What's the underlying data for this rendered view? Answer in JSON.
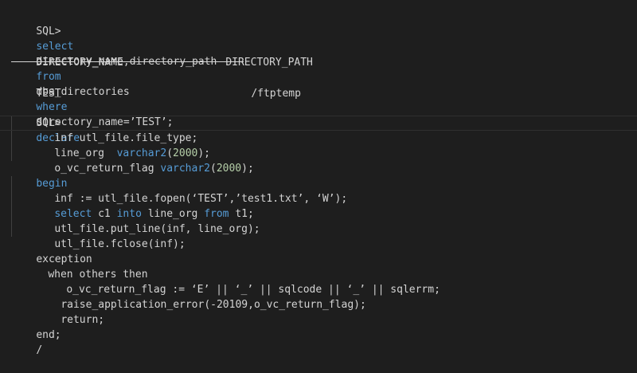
{
  "query": {
    "prompt": "SQL>",
    "kw_select": "select",
    "columns": "directory_name,directory_path",
    "kw_from": "from",
    "table": "dba_directories",
    "kw_where": "where",
    "condition": "directory_name=’TEST’;"
  },
  "result": {
    "headers": [
      "DIRECTORY_NAME",
      "DIRECTORY_PATH"
    ],
    "rows": [
      [
        "TEST",
        "/ftptemp"
      ]
    ]
  },
  "block": {
    "prompt": "SQL>",
    "kw_declare": "declare",
    "l1": "inf utl_file.file_type;",
    "l2_a": "line_org",
    "l2_kw": "varchar2",
    "l2_num": "2000",
    "l3_a": "o_vc_return_flag",
    "l3_kw": "varchar2",
    "l3_num": "2000",
    "kw_begin": "begin",
    "l5": "inf := utl_file.fopen(‘TEST’,’test1.txt’, ‘W’);",
    "l6_kw1": "select",
    "l6_a": "c1",
    "l6_kw2": "into",
    "l6_b": "line_org",
    "l6_kw3": "from",
    "l6_c": "t1;",
    "l7": "utl_file.put_line(inf, line_org);",
    "l8": "utl_file.fclose(inf);",
    "l9": "exception",
    "l10": "when others then",
    "l11": "o_vc_return_flag := ‘E’ || ‘_’ || sqlcode || ‘_’ || sqlerrm;",
    "l12": "raise_application_error(-20109,o_vc_return_flag);",
    "l13": "return;",
    "l14": "end;",
    "l15": "/"
  },
  "colors": {
    "background": "#1e1e1e",
    "text": "#d4d4d4",
    "keyword": "#569cd6",
    "number": "#b5cea8"
  }
}
